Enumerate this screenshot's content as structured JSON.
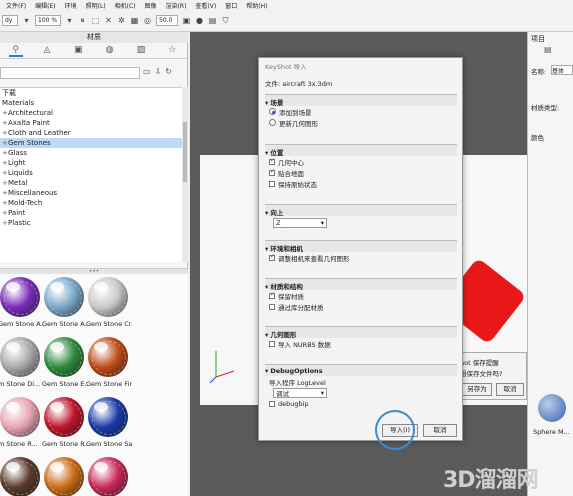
{
  "menubar": [
    "文件(F)",
    "编辑(E)",
    "环境",
    "照明(L)",
    "相机(C)",
    "图像",
    "渲染(R)",
    "查看(V)",
    "窗口",
    "帮助(H)"
  ],
  "toolbar": {
    "mode_value": "dy",
    "zoom_value": "100 %",
    "number_value": "50.0"
  },
  "left_panel": {
    "title": "材质",
    "search_placeholder": "",
    "tree": {
      "root": "下载",
      "folder": "Materials",
      "items": [
        "Architectural",
        "Axalta Paint",
        "Cloth and Leather",
        "Gem Stones",
        "Glass",
        "Light",
        "Liquids",
        "Metal",
        "Miscellaneous",
        "Mold-Tech",
        "Paint",
        "Plastic"
      ],
      "selected": "Gem Stones"
    },
    "tiles": [
      {
        "label": "Gem Stone A...",
        "color": "#7a2bb8"
      },
      {
        "label": "Gem Stone A...",
        "color": "#7aa7c8"
      },
      {
        "label": "Gem Stone Cr...",
        "color": "#c8c8c8"
      },
      {
        "label": "m Stone Di...",
        "color": "#a8a8a8"
      },
      {
        "label": "Gem Stone E...",
        "color": "#2e8a3c"
      },
      {
        "label": "Gem Stone Fir...",
        "color": "#c04a18"
      },
      {
        "label": "m Stone R...",
        "color": "#e6a3b3"
      },
      {
        "label": "Gem Stone R...",
        "color": "#c0142a"
      },
      {
        "label": "Gem Stone Sa...",
        "color": "#1a3aa8"
      },
      {
        "label": "m Stone S...",
        "color": "#5a3a2a"
      },
      {
        "label": "Gem Stone T...",
        "color": "#c86a14"
      },
      {
        "label": "Gem Stone T...",
        "color": "#c8285a"
      }
    ]
  },
  "right_panel": {
    "tab": "项目",
    "row1_label": "名称:",
    "row1_value": "基体",
    "row2_label": "材质类型:",
    "row3_label": "颜色",
    "sphere_label": "Sphere M..."
  },
  "save_dialog": {
    "line1": "hot 保存提醒",
    "line2": "想保存文件吗?",
    "btn_saveas": "另存为",
    "btn_cancel": "取消"
  },
  "dialog": {
    "title": "KeyShot 导入",
    "file_label": "文件: aircraft 3x.3dm",
    "sections": {
      "scene": "场景",
      "scene_opt1": "添加到场景",
      "scene_opt2": "更新几何图形",
      "position": "位置",
      "pos_opt1": "几何中心",
      "pos_opt2": "贴合地面",
      "pos_opt3": "保持原始状态",
      "up": "向上",
      "up_value": "Z",
      "env_cam": "环境和相机",
      "env_opt1": "调整相机来查看几何图形",
      "mat_struct": "材质和结构",
      "mat_opt1": "保留材质",
      "mat_opt2": "通过库分配材质",
      "geometry": "几何图形",
      "geo_opt1": "导入 NURBS 数据",
      "debug": "DebugOptions",
      "debug_label": "导入程序 LogLevel",
      "debug_value": "调试",
      "debug_opt1": "debugbip"
    },
    "btn_import": "导入(I)",
    "btn_cancel": "取消"
  },
  "watermark": "3D溜溜网"
}
